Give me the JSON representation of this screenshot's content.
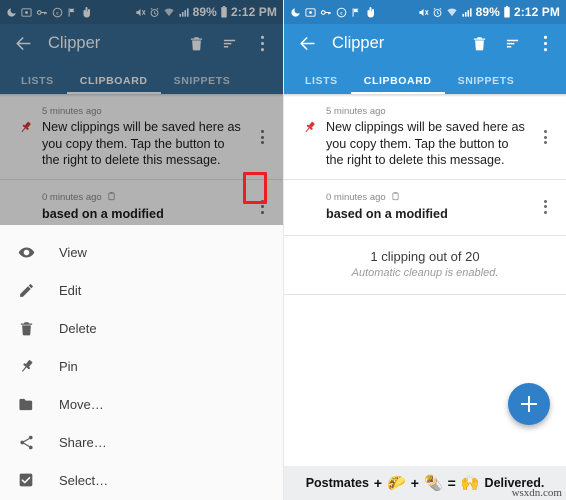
{
  "colors": {
    "accent_right": "#2f8fd5",
    "accent_left": "#3a6f99",
    "statusbar_right": "#2a7fc0",
    "statusbar_left": "#33638a",
    "fab": "#2f80c8",
    "highlight_box": "#ee1c25",
    "pin_red": "#d93636"
  },
  "statusbar": {
    "icons_left": [
      "do-not-disturb-icon",
      "screenshot-icon",
      "key-icon",
      "copyright-icon",
      "flag-icon",
      "pointer-hand-icon"
    ],
    "icons_right": [
      "mute-icon",
      "alarm-icon",
      "wifi-icon",
      "signal-icon"
    ],
    "battery": "89%",
    "battery_icon": "battery-icon",
    "time": "2:12 PM"
  },
  "toolbar": {
    "back_icon": "back-arrow-icon",
    "title": "Clipper",
    "actions": [
      {
        "name": "delete-icon",
        "label": "Delete"
      },
      {
        "name": "sort-icon",
        "label": "Sort"
      },
      {
        "name": "overflow-menu-icon",
        "label": "More options"
      }
    ]
  },
  "tabs": [
    {
      "label": "LISTS",
      "active": false
    },
    {
      "label": "CLIPBOARD",
      "active": true
    },
    {
      "label": "SNIPPETS",
      "active": false
    }
  ],
  "clippings": [
    {
      "time": "5 minutes ago",
      "text": "New clippings will be saved here as you copy them. Tap the button to the right to delete this message.",
      "pinned": true,
      "bold": false,
      "has_clipboard_icon": false
    },
    {
      "time": "0 minutes ago",
      "text": "based on a modified",
      "pinned": false,
      "bold": true,
      "has_clipboard_icon": true
    }
  ],
  "footer": {
    "count": "1 clipping out of 20",
    "cleanup": "Automatic cleanup is enabled."
  },
  "context_menu": [
    {
      "icon": "eye-icon",
      "label": "View"
    },
    {
      "icon": "pencil-icon",
      "label": "Edit"
    },
    {
      "icon": "trash-icon",
      "label": "Delete"
    },
    {
      "icon": "pin-icon",
      "label": "Pin"
    },
    {
      "icon": "folder-icon",
      "label": "Move…"
    },
    {
      "icon": "share-icon",
      "label": "Share…"
    },
    {
      "icon": "checkbox-icon",
      "label": "Select…"
    }
  ],
  "fab": {
    "icon": "plus-icon",
    "label": "Add clipping"
  },
  "ad": {
    "brand": "Postmates",
    "plus1": "+",
    "emoji1": "🌮",
    "plus2": "+",
    "emoji2": "🌯",
    "equals": "=",
    "emoji3": "🙌",
    "closing": "Delivered.",
    "watermark": "wsxdn.com"
  }
}
